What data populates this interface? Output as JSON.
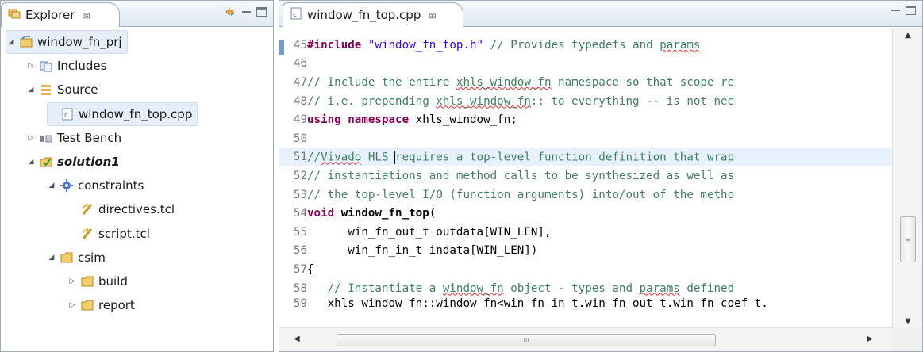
{
  "explorer": {
    "tab_label": "Explorer",
    "tab_close": "⊠",
    "tree": [
      {
        "label": "window_fn_prj",
        "icon": "project-icon",
        "twisty": "◢",
        "indent": 0,
        "selected": true
      },
      {
        "label": "Includes",
        "icon": "includes-icon",
        "twisty": "▷",
        "indent": 1
      },
      {
        "label": "Source",
        "icon": "source-icon",
        "twisty": "◢",
        "indent": 1
      },
      {
        "label": "window_fn_top.cpp",
        "icon": "cpp-file-icon",
        "twisty": "",
        "indent": 2,
        "selected": true
      },
      {
        "label": "Test Bench",
        "icon": "testbench-icon",
        "twisty": "▷",
        "indent": 1
      },
      {
        "label": "solution1",
        "icon": "solution-icon",
        "twisty": "◢",
        "indent": 1,
        "bold": true
      },
      {
        "label": "constraints",
        "icon": "constraints-icon",
        "twisty": "◢",
        "indent": 2
      },
      {
        "label": "directives.tcl",
        "icon": "tcl-file-icon",
        "twisty": "",
        "indent": 3
      },
      {
        "label": "script.tcl",
        "icon": "tcl-file-icon",
        "twisty": "",
        "indent": 3
      },
      {
        "label": "csim",
        "icon": "folder-icon",
        "twisty": "◢",
        "indent": 2
      },
      {
        "label": "build",
        "icon": "folder-icon",
        "twisty": "▷",
        "indent": 3
      },
      {
        "label": "report",
        "icon": "folder-icon",
        "twisty": "▷",
        "indent": 3
      }
    ]
  },
  "editor": {
    "tab_label": "window_fn_top.cpp",
    "tab_close": "⊠",
    "lines": [
      {
        "n": "45",
        "parts": [
          [
            "pp",
            "#include"
          ],
          [
            "code",
            " "
          ],
          [
            "str",
            "\"window_fn_top.h\""
          ],
          [
            "cm",
            " // Provides typedefs and "
          ],
          [
            "cmsq",
            "params"
          ]
        ]
      },
      {
        "n": "46",
        "parts": []
      },
      {
        "n": "47",
        "parts": [
          [
            "cm",
            "// Include the entire "
          ],
          [
            "cmsq",
            "xhls_window_fn"
          ],
          [
            "cm",
            " namespace so that scope re"
          ]
        ]
      },
      {
        "n": "48",
        "parts": [
          [
            "cm",
            "// i.e. prepending "
          ],
          [
            "cmsq",
            "xhls_window_fn"
          ],
          [
            "cm",
            ":: to everything -- is not nee"
          ]
        ]
      },
      {
        "n": "49",
        "parts": [
          [
            "kw",
            "using"
          ],
          [
            "code",
            " "
          ],
          [
            "kw",
            "namespace"
          ],
          [
            "code",
            " xhls_window_fn;"
          ]
        ]
      },
      {
        "n": "50",
        "parts": []
      },
      {
        "n": "51",
        "parts": [
          [
            "cm",
            "//"
          ],
          [
            "cmsq",
            "Vivado"
          ],
          [
            "cm",
            " HLS "
          ],
          [
            "caret",
            ""
          ],
          [
            "cm",
            "requires a top-level function definition that wrap"
          ]
        ],
        "current": true
      },
      {
        "n": "52",
        "parts": [
          [
            "cm",
            "// instantiations and method calls to be synthesized as well as"
          ]
        ]
      },
      {
        "n": "53",
        "parts": [
          [
            "cm",
            "// the top-level I/O (function arguments) into/out of the metho"
          ]
        ]
      },
      {
        "n": "54",
        "parts": [
          [
            "kw",
            "void"
          ],
          [
            "code",
            " "
          ],
          [
            "fn",
            "window_fn_top"
          ],
          [
            "code",
            "("
          ]
        ]
      },
      {
        "n": "55",
        "parts": [
          [
            "code",
            "      win_fn_out_t outdata[WIN_LEN],"
          ]
        ]
      },
      {
        "n": "56",
        "parts": [
          [
            "code",
            "      win_fn_in_t indata[WIN_LEN])"
          ]
        ]
      },
      {
        "n": "57",
        "parts": [
          [
            "code",
            "{"
          ]
        ]
      },
      {
        "n": "58",
        "parts": [
          [
            "cm",
            "   // Instantiate a "
          ],
          [
            "cmsq",
            "window_fn"
          ],
          [
            "cm",
            " object - types and "
          ],
          [
            "cmsq",
            "params"
          ],
          [
            "cm",
            " defined"
          ]
        ]
      },
      {
        "n": "59",
        "parts": [
          [
            "code",
            "   xhls_window_fn::window_fn<win_fn_in_t,win_fn_out_t,win_fn_coef_t,"
          ]
        ],
        "clipped": true
      }
    ]
  },
  "scroll": {
    "v_thumb_grip": "≡",
    "h_thumb_grip": "III",
    "up": "▲",
    "down": "▼",
    "left": "◀",
    "right": "▶"
  },
  "colors": {
    "keyword": "#7f0055",
    "string": "#2a00ff",
    "comment": "#3f7f5f",
    "current_line": "#e8f2fe",
    "selection": "#e6eef9"
  }
}
